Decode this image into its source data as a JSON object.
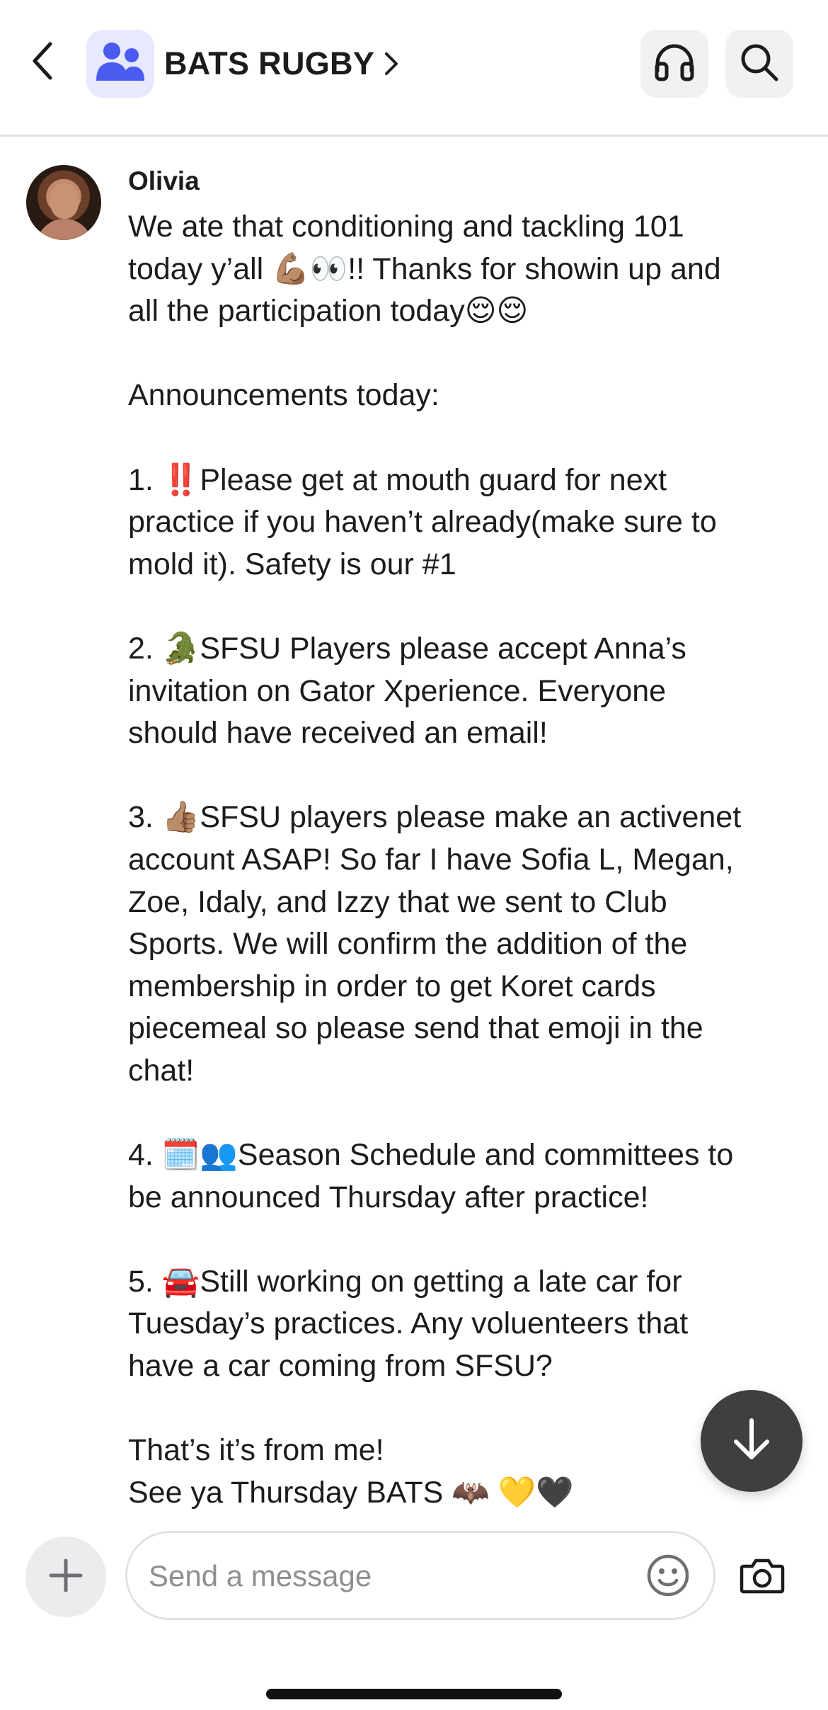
{
  "header": {
    "group_name": "BATS RUGBY",
    "icons": {
      "back": "chevron-left-icon",
      "group": "group-people-icon",
      "title_chevron": "chevron-right-icon",
      "audio": "headphones-icon",
      "search": "search-icon"
    }
  },
  "message": {
    "author": "Olivia",
    "paragraphs": [
      "We ate that conditioning and tackling 101\ntoday y’all 💪🏽👀!! Thanks for showin up and\nall the participation today😌😌",
      "Announcements today:",
      "1. ‼️Please get at mouth guard for next\npractice if you haven’t already(make sure to\nmold it). Safety is our #1",
      "2. 🐊SFSU Players please accept Anna’s\ninvitation on Gator Xperience. Everyone\nshould have received an email!",
      "3. 👍🏽SFSU players please make an activenet\naccount ASAP! So far I have Sofia L, Megan,\nZoe, Idaly, and Izzy that we sent to Club\nSports. We will confirm the addition of the\nmembership in order to get Koret cards\npiecemeal so please send that emoji in the\nchat!",
      "4. 🗓️👥Season Schedule and committees to\nbe announced Thursday after practice!",
      "5. 🚘Still working on getting a late car for\nTuesday’s practices. Any voluenteers that\nhave a car coming from SFSU?",
      "That’s it’s from me!\nSee ya Thursday BATS 🦇 💛🖤"
    ]
  },
  "scroll_button": {
    "icon": "arrow-down-icon"
  },
  "composer": {
    "placeholder": "Send a message",
    "value": "",
    "icons": {
      "add": "plus-icon",
      "emoji": "smiley-icon",
      "camera": "camera-icon"
    }
  },
  "colors": {
    "group_avatar_bg": "#e6e9ff",
    "group_avatar_fg": "#4a5bf0",
    "fab_bg": "#3f3f42",
    "header_button_bg": "#f1f1f3"
  }
}
